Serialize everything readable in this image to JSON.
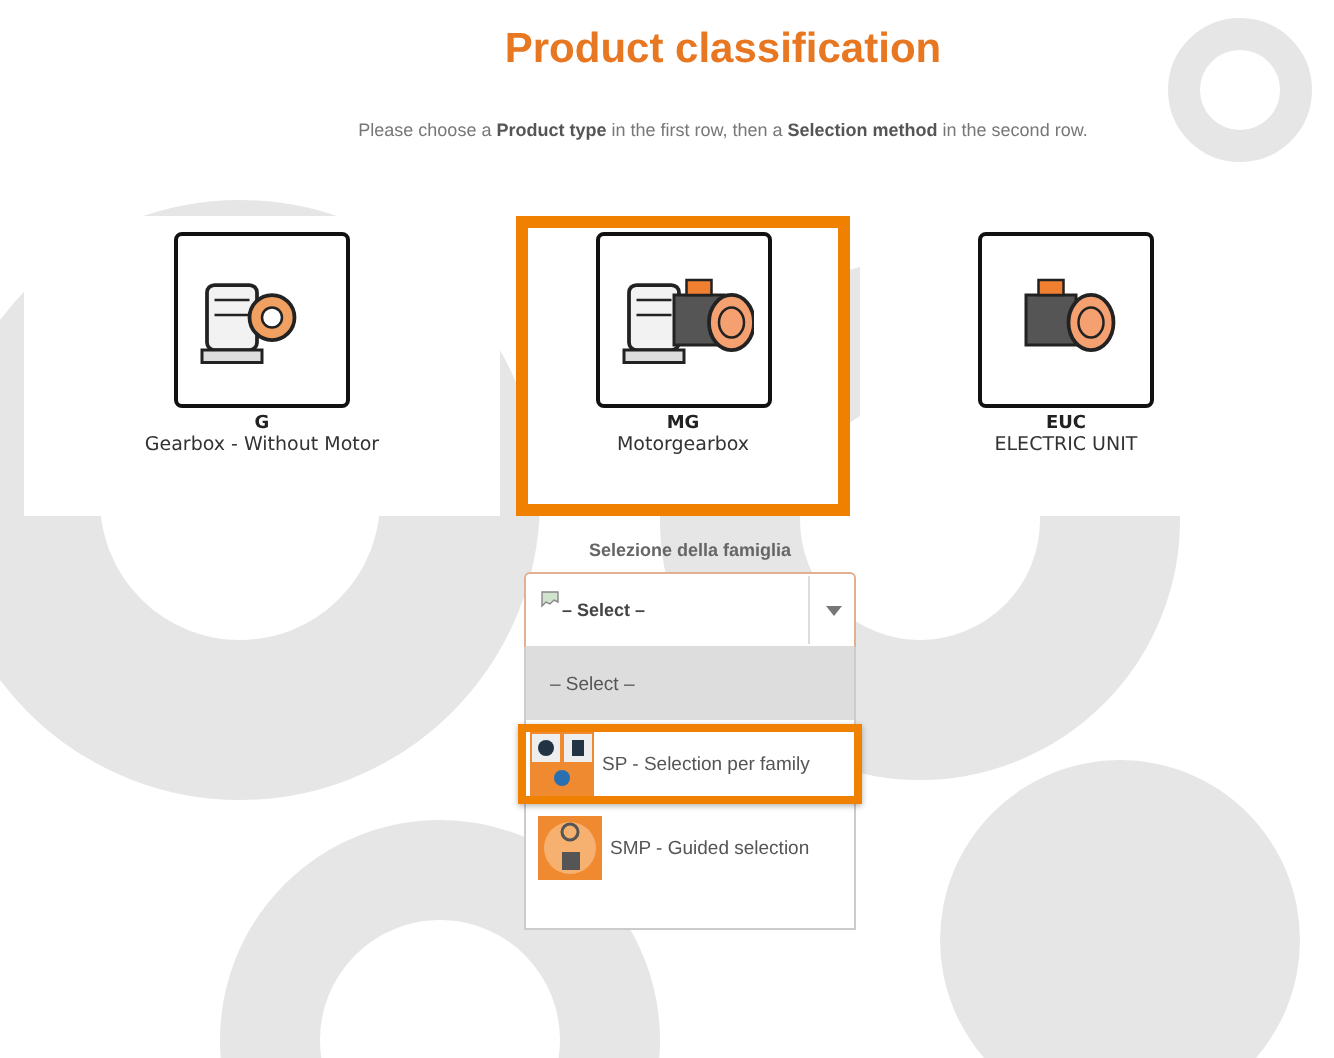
{
  "title": "Product classification",
  "intro": "Please choose a **Product type** in the first row, then a **Selection method** in the second row.",
  "products": [
    {
      "code": "G",
      "name": "Gearbox - Without Motor",
      "selected": false,
      "kind": "gearbox"
    },
    {
      "code": "MG",
      "name": "Motorgearbox",
      "selected": true,
      "kind": "motorgearbox"
    },
    {
      "code": "EUC",
      "name": "ELECTRIC UNIT",
      "selected": false,
      "kind": "motor"
    }
  ],
  "family_select": {
    "label": "Selezione della famiglia",
    "value": "– Select –",
    "expanded": true,
    "options": [
      {
        "label": "– Select –",
        "kind": "none",
        "highlighted": false,
        "selected": true
      },
      {
        "label": "SP - Selection per family",
        "kind": "family",
        "highlighted": true,
        "selected": false
      },
      {
        "label": "SMP - Guided selection",
        "kind": "guided",
        "highlighted": false,
        "selected": false
      }
    ]
  }
}
